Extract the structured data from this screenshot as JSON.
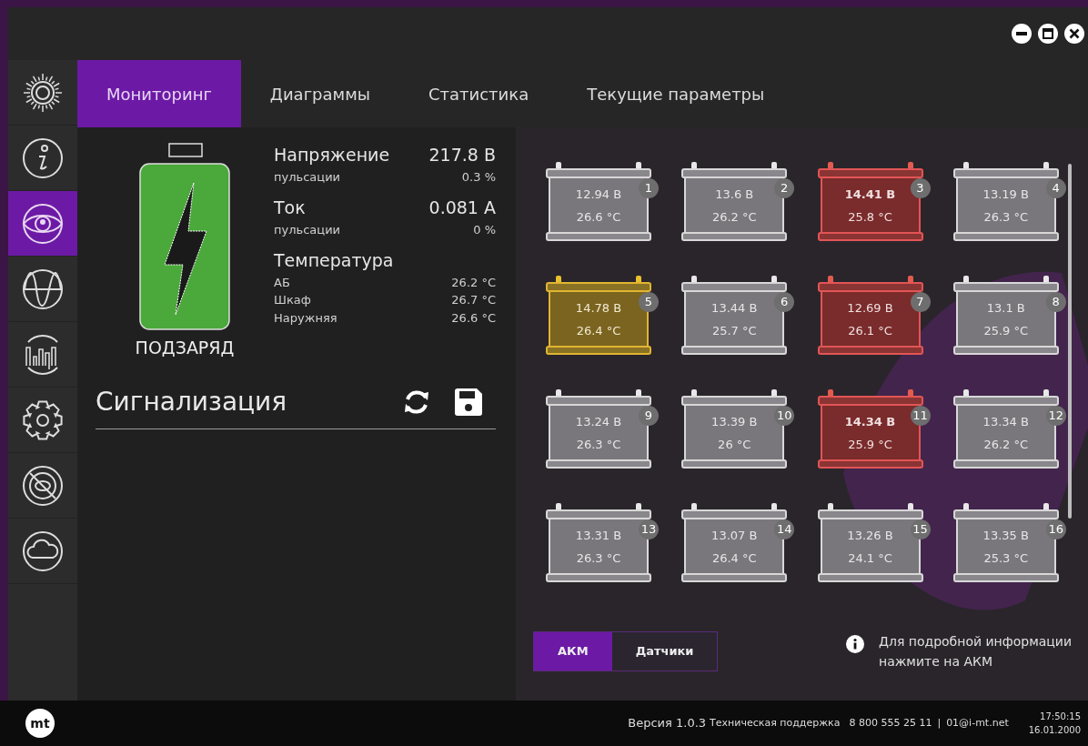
{
  "sidebar": {
    "items": [
      {
        "kind": "sun",
        "selected": false
      },
      {
        "kind": "info",
        "selected": false
      },
      {
        "kind": "eye",
        "selected": true
      },
      {
        "kind": "wave",
        "selected": false
      },
      {
        "kind": "bars",
        "selected": false
      },
      {
        "kind": "gear",
        "selected": false
      },
      {
        "kind": "lens",
        "selected": false
      },
      {
        "kind": "cloud",
        "selected": false
      }
    ]
  },
  "tabs": [
    {
      "label": "Мониторинг",
      "selected": true
    },
    {
      "label": "Диаграммы",
      "selected": false
    },
    {
      "label": "Статистика",
      "selected": false
    },
    {
      "label": "Текущие параметры",
      "selected": false
    }
  ],
  "battery_status": {
    "label": "ПОДЗАРЯД",
    "color": "#4aa93a"
  },
  "readings": [
    {
      "kind": "main",
      "label": "Напряжение",
      "value": "217.8 В"
    },
    {
      "kind": "sub",
      "label": "пульсации",
      "value": "0.3 %"
    },
    {
      "kind": "main",
      "label": "Ток",
      "value": "0.081 А"
    },
    {
      "kind": "sub",
      "label": "пульсации",
      "value": "0 %"
    },
    {
      "kind": "main",
      "label": "Температура"
    },
    {
      "kind": "sub",
      "label": "АБ",
      "value": "26.2 °C"
    },
    {
      "kind": "sub",
      "label": "Шкаф",
      "value": "26.7 °C"
    },
    {
      "kind": "sub",
      "label": "Наружняя",
      "value": "26.6 °C"
    }
  ],
  "alarms": {
    "title": "Сигнализация"
  },
  "batteries": [
    {
      "number": "1",
      "voltage": "12.94 В",
      "temperature": "26.6 °C",
      "kind": "normal",
      "bold": false
    },
    {
      "number": "2",
      "voltage": "13.6 В",
      "temperature": "26.2 °C",
      "kind": "normal",
      "bold": false
    },
    {
      "number": "3",
      "voltage": "14.41 В",
      "temperature": "25.8 °C",
      "kind": "alarm",
      "bold": true
    },
    {
      "number": "4",
      "voltage": "13.19 В",
      "temperature": "26.3 °C",
      "kind": "normal",
      "bold": false
    },
    {
      "number": "5",
      "voltage": "14.78 В",
      "temperature": "26.4 °C",
      "kind": "warning",
      "bold": false
    },
    {
      "number": "6",
      "voltage": "13.44 В",
      "temperature": "25.7 °C",
      "kind": "normal",
      "bold": false
    },
    {
      "number": "7",
      "voltage": "12.69 В",
      "temperature": "26.1 °C",
      "kind": "alarm",
      "bold": false
    },
    {
      "number": "8",
      "voltage": "13.1 В",
      "temperature": "25.9 °C",
      "kind": "normal",
      "bold": false
    },
    {
      "number": "9",
      "voltage": "13.24 В",
      "temperature": "26.3 °C",
      "kind": "normal",
      "bold": false
    },
    {
      "number": "10",
      "voltage": "13.39 В",
      "temperature": "26 °C",
      "kind": "normal",
      "bold": false
    },
    {
      "number": "11",
      "voltage": "14.34 В",
      "temperature": "25.9 °C",
      "kind": "alarm",
      "bold": true
    },
    {
      "number": "12",
      "voltage": "13.34 В",
      "temperature": "26.2 °C",
      "kind": "normal",
      "bold": false
    },
    {
      "number": "13",
      "voltage": "13.31 В",
      "temperature": "26.3 °C",
      "kind": "normal",
      "bold": false
    },
    {
      "number": "14",
      "voltage": "13.07 В",
      "temperature": "26.4 °C",
      "kind": "normal",
      "bold": false
    },
    {
      "number": "15",
      "voltage": "13.26 В",
      "temperature": "24.1 °C",
      "kind": "normal",
      "bold": false
    },
    {
      "number": "16",
      "voltage": "13.35 В",
      "temperature": "25.3 °C",
      "kind": "normal",
      "bold": false
    }
  ],
  "view_toggle": [
    {
      "label": "АКМ",
      "selected": true
    },
    {
      "label": "Датчики",
      "selected": false
    }
  ],
  "hint": "Для подробной информации нажмите на АКМ",
  "status_bar": {
    "logo": "mt",
    "version": "Версия 1.0.3",
    "support_label": "Техническая поддержка",
    "phone": "8 800 555 25 11",
    "separator": "|",
    "email": "01@i-mt.net",
    "time": "17:50:15",
    "date": "16.01.2000"
  }
}
